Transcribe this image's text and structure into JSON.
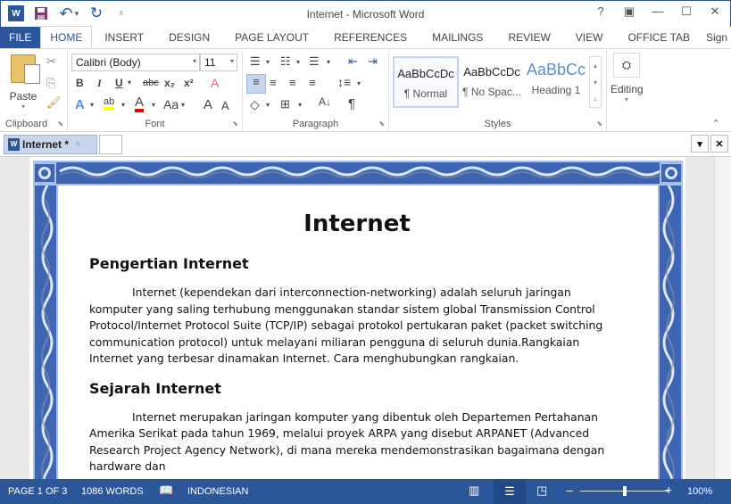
{
  "window": {
    "title": "Internet - Microsoft Word",
    "controls": {
      "help": "?",
      "ribbon_options": "▣",
      "minimize": "—",
      "maximize": "☐",
      "close": "✕"
    }
  },
  "qat": {
    "word_logo": "W",
    "save": "save-icon",
    "undo": "↶",
    "undo_dd": "▾",
    "redo": "↻",
    "customize": "⩡"
  },
  "tabs": [
    {
      "label": "FILE"
    },
    {
      "label": "HOME"
    },
    {
      "label": "INSERT"
    },
    {
      "label": "DESIGN"
    },
    {
      "label": "PAGE LAYOUT"
    },
    {
      "label": "REFERENCES"
    },
    {
      "label": "MAILINGS"
    },
    {
      "label": "REVIEW"
    },
    {
      "label": "VIEW"
    },
    {
      "label": "OFFICE TAB"
    },
    {
      "label": "Sign"
    }
  ],
  "ribbon": {
    "clipboard": {
      "label": "Clipboard",
      "paste": "Paste"
    },
    "font": {
      "label": "Font",
      "font_name": "Calibri (Body)",
      "font_size": "11",
      "bold": "B",
      "italic": "I",
      "underline": "U",
      "strike": "abc",
      "subscript": "x₂",
      "superscript": "x²",
      "text_effects": "A",
      "highlight": "ab",
      "font_color": "A",
      "change_case": "Aa",
      "grow": "A",
      "shrink": "A",
      "highlight_color": "#ffff00",
      "font_color_value": "#e00000"
    },
    "paragraph": {
      "label": "Paragraph",
      "pilcrow": "¶"
    },
    "styles": {
      "label": "Styles",
      "items": [
        {
          "preview": "AaBbCcDc",
          "name": "¶ Normal"
        },
        {
          "preview": "AaBbCcDc",
          "name": "¶ No Spac..."
        },
        {
          "preview": "AaBbCc",
          "name": "Heading 1"
        }
      ]
    },
    "editing": {
      "label": "Editing"
    }
  },
  "doc_tab": {
    "label": "Internet *",
    "close": "×"
  },
  "document": {
    "title": "Internet",
    "sections": [
      {
        "heading": "Pengertian Internet",
        "body": "Internet (kependekan dari interconnection-networking) adalah seluruh jaringan komputer yang saling terhubung menggunakan standar sistem global Transmission Control Protocol/Internet Protocol Suite (TCP/IP) sebagai protokol pertukaran paket (packet switching communication protocol) untuk melayani miliaran pengguna di seluruh dunia.Rangkaian Internet yang terbesar dinamakan Internet. Cara menghubungkan rangkaian."
      },
      {
        "heading": "Sejarah Internet",
        "body": "Internet merupakan jaringan komputer yang dibentuk oleh Departemen Pertahanan Amerika Serikat pada tahun 1969, melalui proyek ARPA yang disebut ARPANET (Advanced Research Project Agency Network), di mana mereka mendemonstrasikan bagaimana dengan hardware dan"
      }
    ]
  },
  "status": {
    "page": "PAGE 1 OF 3",
    "words": "1086 WORDS",
    "language": "INDONESIAN",
    "zoom": "100%",
    "zoom_value": 100
  },
  "colors": {
    "accent": "#2b579a",
    "border_blue": "#3d65b4"
  }
}
